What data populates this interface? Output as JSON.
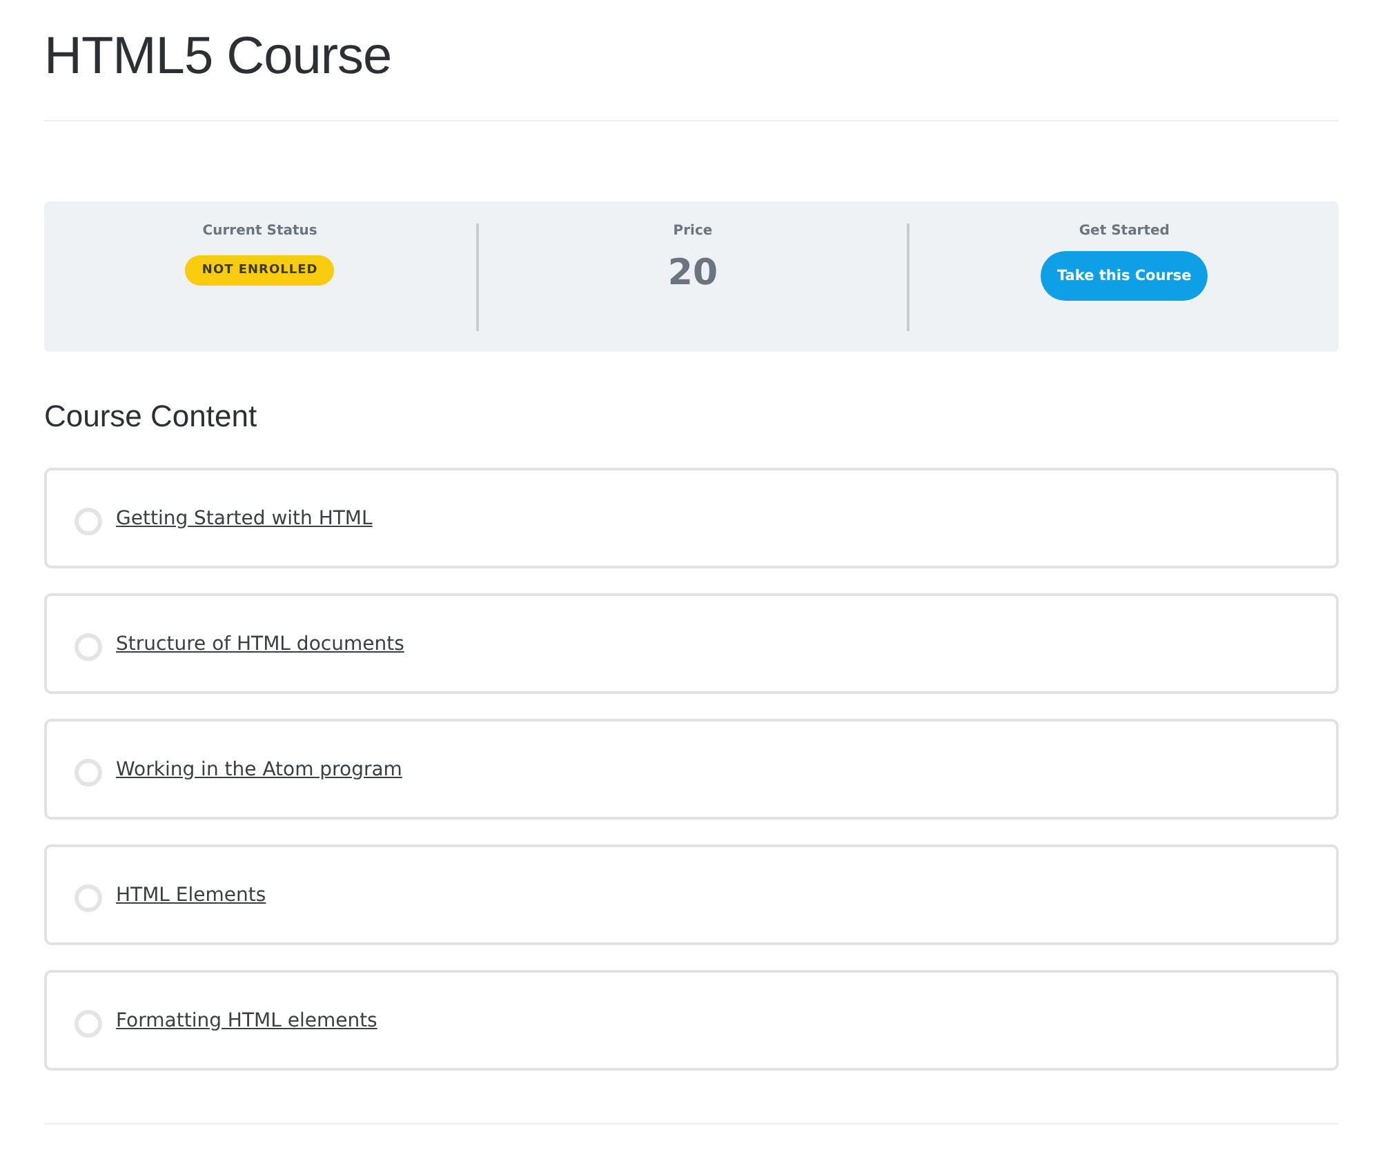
{
  "title": "HTML5 Course",
  "info": [
    {
      "kind": "status",
      "label": "Current Status",
      "value": "NOT ENROLLED"
    },
    {
      "kind": "price",
      "label": "Price",
      "value": "20"
    },
    {
      "kind": "action",
      "label": "Get Started",
      "value": "Take this Course"
    }
  ],
  "content_title": "Course Content",
  "lessons": [
    {
      "title": "Getting Started with HTML",
      "completed": false
    },
    {
      "title": "Structure of HTML documents",
      "completed": false
    },
    {
      "title": "Working in the Atom program",
      "completed": false
    },
    {
      "title": "HTML Elements",
      "completed": false
    },
    {
      "title": "Formatting HTML elements",
      "completed": false
    }
  ]
}
